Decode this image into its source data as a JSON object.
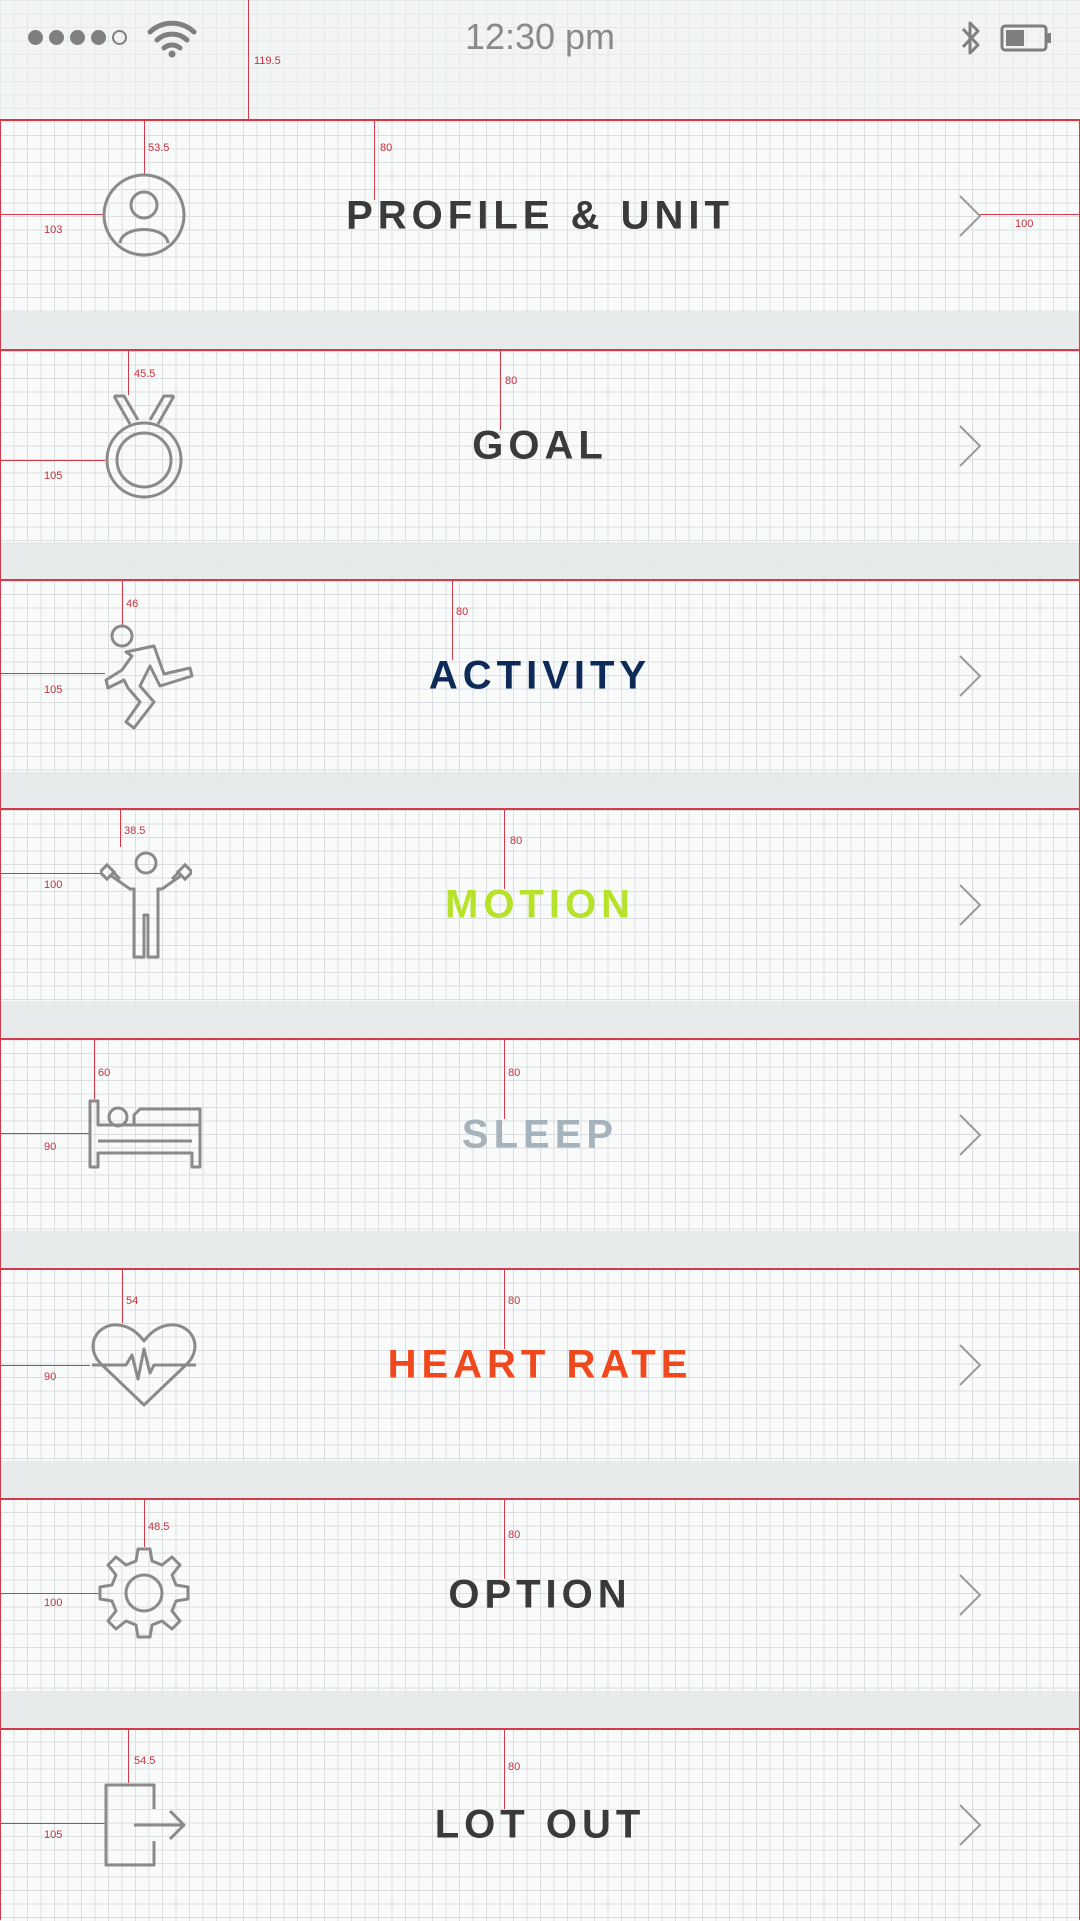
{
  "status_bar": {
    "time": "12:30 pm",
    "icons": [
      "signal-dots",
      "wifi-icon",
      "bluetooth-icon",
      "battery-icon"
    ],
    "annotation": "119.5"
  },
  "menu": [
    {
      "label": "PROFILE & UNIT",
      "icon": "profile-icon",
      "color": "#3a3a3a",
      "top_spacing": "53.5",
      "left_spacing": "103",
      "title_spacing": "80",
      "right_spacing": "100"
    },
    {
      "label": "GOAL",
      "icon": "medal-icon",
      "color": "#3a3a3a",
      "top_spacing": "45.5",
      "left_spacing": "105",
      "title_spacing": "80"
    },
    {
      "label": "ACTIVITY",
      "icon": "running-icon",
      "color": "#0d2a59",
      "top_spacing": "46",
      "left_spacing": "105",
      "title_spacing": "80"
    },
    {
      "label": "MOTION",
      "icon": "weightlifting-icon",
      "color": "#b7e22a",
      "top_spacing": "38.5",
      "left_spacing": "100",
      "title_spacing": "80"
    },
    {
      "label": "SLEEP",
      "icon": "bed-icon",
      "color": "#a7b3bc",
      "top_spacing": "60",
      "left_spacing": "90",
      "title_spacing": "80"
    },
    {
      "label": "HEART RATE",
      "icon": "heart-rate-icon",
      "color": "#f0481d",
      "top_spacing": "54",
      "left_spacing": "90",
      "title_spacing": "80"
    },
    {
      "label": "OPTION",
      "icon": "gear-icon",
      "color": "#3a3a3a",
      "top_spacing": "48.5",
      "left_spacing": "100",
      "title_spacing": "80"
    },
    {
      "label": "LOT OUT",
      "icon": "logout-icon",
      "color": "#3a3a3a",
      "top_spacing": "54.5",
      "left_spacing": "105",
      "title_spacing": "80"
    }
  ]
}
